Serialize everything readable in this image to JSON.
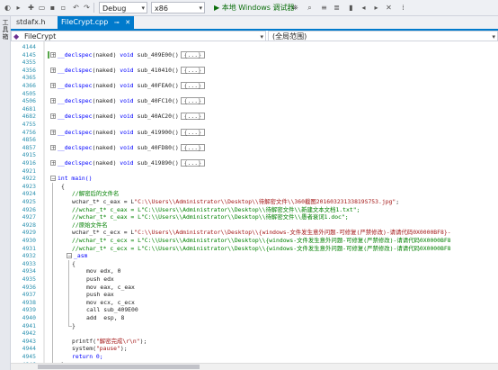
{
  "toolbar": {
    "config": "Debug",
    "platform": "x86",
    "run_label": "▶ 本地 Windows 调试器",
    "icons": [
      "back-icon",
      "forward-icon",
      "new-item-icon",
      "open-icon",
      "save-icon",
      "save-all-icon",
      "undo-icon",
      "redo-icon",
      "attach-icon",
      "find-icon",
      "comment-icon",
      "uncomment-icon",
      "bookmark-icon",
      "prev-bookmark-icon",
      "next-bookmark-icon",
      "clear-bookmark-icon",
      "overflow-icon"
    ]
  },
  "left_strip": {
    "label": "工具箱"
  },
  "tabs": [
    {
      "label": "stdafx.h",
      "active": false
    },
    {
      "label": "FileCrypt.cpp",
      "active": true
    }
  ],
  "nav": {
    "project": "FileCrypt",
    "scope": "(全局范围)"
  },
  "code_lines": [
    {
      "ln": "4144",
      "text": ""
    },
    {
      "ln": "4145",
      "fold": "+",
      "collapsed": true,
      "changed": true,
      "fn": "sub_409E00",
      "ellipsis": "{...}"
    },
    {
      "ln": "4355",
      "text": ""
    },
    {
      "ln": "4356",
      "fold": "+",
      "collapsed": true,
      "fn": "sub_410410",
      "ellipsis": "{...}"
    },
    {
      "ln": "4365",
      "text": ""
    },
    {
      "ln": "4366",
      "fold": "+",
      "collapsed": true,
      "fn": "sub_40FEA0",
      "ellipsis": "{...}"
    },
    {
      "ln": "4505",
      "text": ""
    },
    {
      "ln": "4506",
      "fold": "+",
      "collapsed": true,
      "fn": "sub_40FC10",
      "ellipsis": "{...}"
    },
    {
      "ln": "4681",
      "text": ""
    },
    {
      "ln": "4682",
      "fold": "+",
      "collapsed": true,
      "fn": "sub_40AC20",
      "ellipsis": "{...}"
    },
    {
      "ln": "4755",
      "text": ""
    },
    {
      "ln": "4756",
      "fold": "+",
      "collapsed": true,
      "fn": "sub_419900",
      "ellipsis": "{...}"
    },
    {
      "ln": "4856",
      "text": ""
    },
    {
      "ln": "4857",
      "fold": "+",
      "collapsed": true,
      "fn": "sub_40FD80",
      "ellipsis": "{...}"
    },
    {
      "ln": "4915",
      "text": ""
    },
    {
      "ln": "4916",
      "fold": "+",
      "collapsed": true,
      "fn": "sub_419890",
      "ellipsis": "{...}"
    },
    {
      "ln": "4921",
      "text": ""
    },
    {
      "ln": "4922",
      "fold": "-",
      "kind": "main",
      "text": "int main()"
    },
    {
      "ln": "4923",
      "indent": 0,
      "text": "{"
    },
    {
      "ln": "4924",
      "indent": 1,
      "cls": "cmt",
      "text": "//解密后的文件名"
    },
    {
      "ln": "4925",
      "indent": 1,
      "kind": "decl",
      "pre": "wchar_t* c_eax = L",
      "str": "\"C:\\\\Users\\\\Administrator\\\\Desktop\\\\待解密文件\\\\360截图20160323133819S753.jpg\"",
      "post": ";"
    },
    {
      "ln": "4926",
      "indent": 1,
      "cls": "cmt",
      "text": "//wchar_t* c_eax = L\"C:\\\\Users\\\\Administrator\\\\Desktop\\\\待解密文件\\\\新建文本文档1.txt\";"
    },
    {
      "ln": "4927",
      "indent": 1,
      "cls": "cmt",
      "text": "//wchar_t* c_eax = L\"C:\\\\Users\\\\Administrator\\\\Desktop\\\\待解密文件\\\\愚者衰词1.doc\";"
    },
    {
      "ln": "4928",
      "indent": 1,
      "cls": "cmt",
      "text": "//原始文件名"
    },
    {
      "ln": "4929",
      "indent": 1,
      "kind": "decl",
      "pre": "wchar_t* c_ecx = L",
      "str": "\"C:\\\\Users\\\\Administrator\\\\Desktop\\\\{windows-文件发生意外问题-可修复(严禁修改)-请请代码0X0000BF8}-",
      "post": ""
    },
    {
      "ln": "4930",
      "indent": 1,
      "cls": "cmt",
      "text": "//wchar_t* c_ecx = L\"C:\\\\Users\\\\Administrator\\\\Desktop\\\\{windows-文件发生意外问题-可修复(严禁修改)-请请代码0X0000BF8"
    },
    {
      "ln": "4931",
      "indent": 1,
      "cls": "cmt",
      "text": "//wchar_t* c_ecx = L\"C:\\\\Users\\\\Administrator\\\\Desktop\\\\{windows-文件发生意外问题-可修复(严禁修改)-请请代码0X0000BF8"
    },
    {
      "ln": "4932",
      "indent": 1,
      "fold": "-",
      "kind": "asm",
      "text": "_asm"
    },
    {
      "ln": "4933",
      "indent": 1,
      "text": "{"
    },
    {
      "ln": "4934",
      "indent": 2,
      "text": "mov edx, 0"
    },
    {
      "ln": "4935",
      "indent": 2,
      "text": "push edx"
    },
    {
      "ln": "4936",
      "indent": 2,
      "text": "mov eax, c_eax"
    },
    {
      "ln": "4937",
      "indent": 2,
      "text": "push eax"
    },
    {
      "ln": "4938",
      "indent": 2,
      "text": "mov ecx, c_ecx"
    },
    {
      "ln": "4939",
      "indent": 2,
      "text": "call sub_409E00"
    },
    {
      "ln": "4940",
      "indent": 2,
      "text": "add  esp, 8"
    },
    {
      "ln": "4941",
      "indent": 1,
      "text": "}"
    },
    {
      "ln": "4942",
      "text": ""
    },
    {
      "ln": "4943",
      "indent": 1,
      "kind": "printf",
      "pre": "printf(",
      "str": "\"解密完成\\r\\n\"",
      "post": ");"
    },
    {
      "ln": "4944",
      "indent": 1,
      "kind": "printf",
      "pre": "system(",
      "str": "\"pause\"",
      "post": ");"
    },
    {
      "ln": "4945",
      "indent": 1,
      "kind": "ret",
      "text": "return 0;"
    },
    {
      "ln": "4946",
      "indent": 0,
      "text": "}"
    },
    {
      "ln": "4947",
      "text": ""
    }
  ],
  "collapsed_prefix_kw": "__declspec",
  "collapsed_prefix_arg": "(naked)",
  "collapsed_void": "void",
  "collapsed_suffix": "()",
  "colors": {
    "accent": "#007acc",
    "keyword": "#0000ff",
    "string": "#a31515",
    "comment": "#008000",
    "line_number": "#2b91af"
  }
}
